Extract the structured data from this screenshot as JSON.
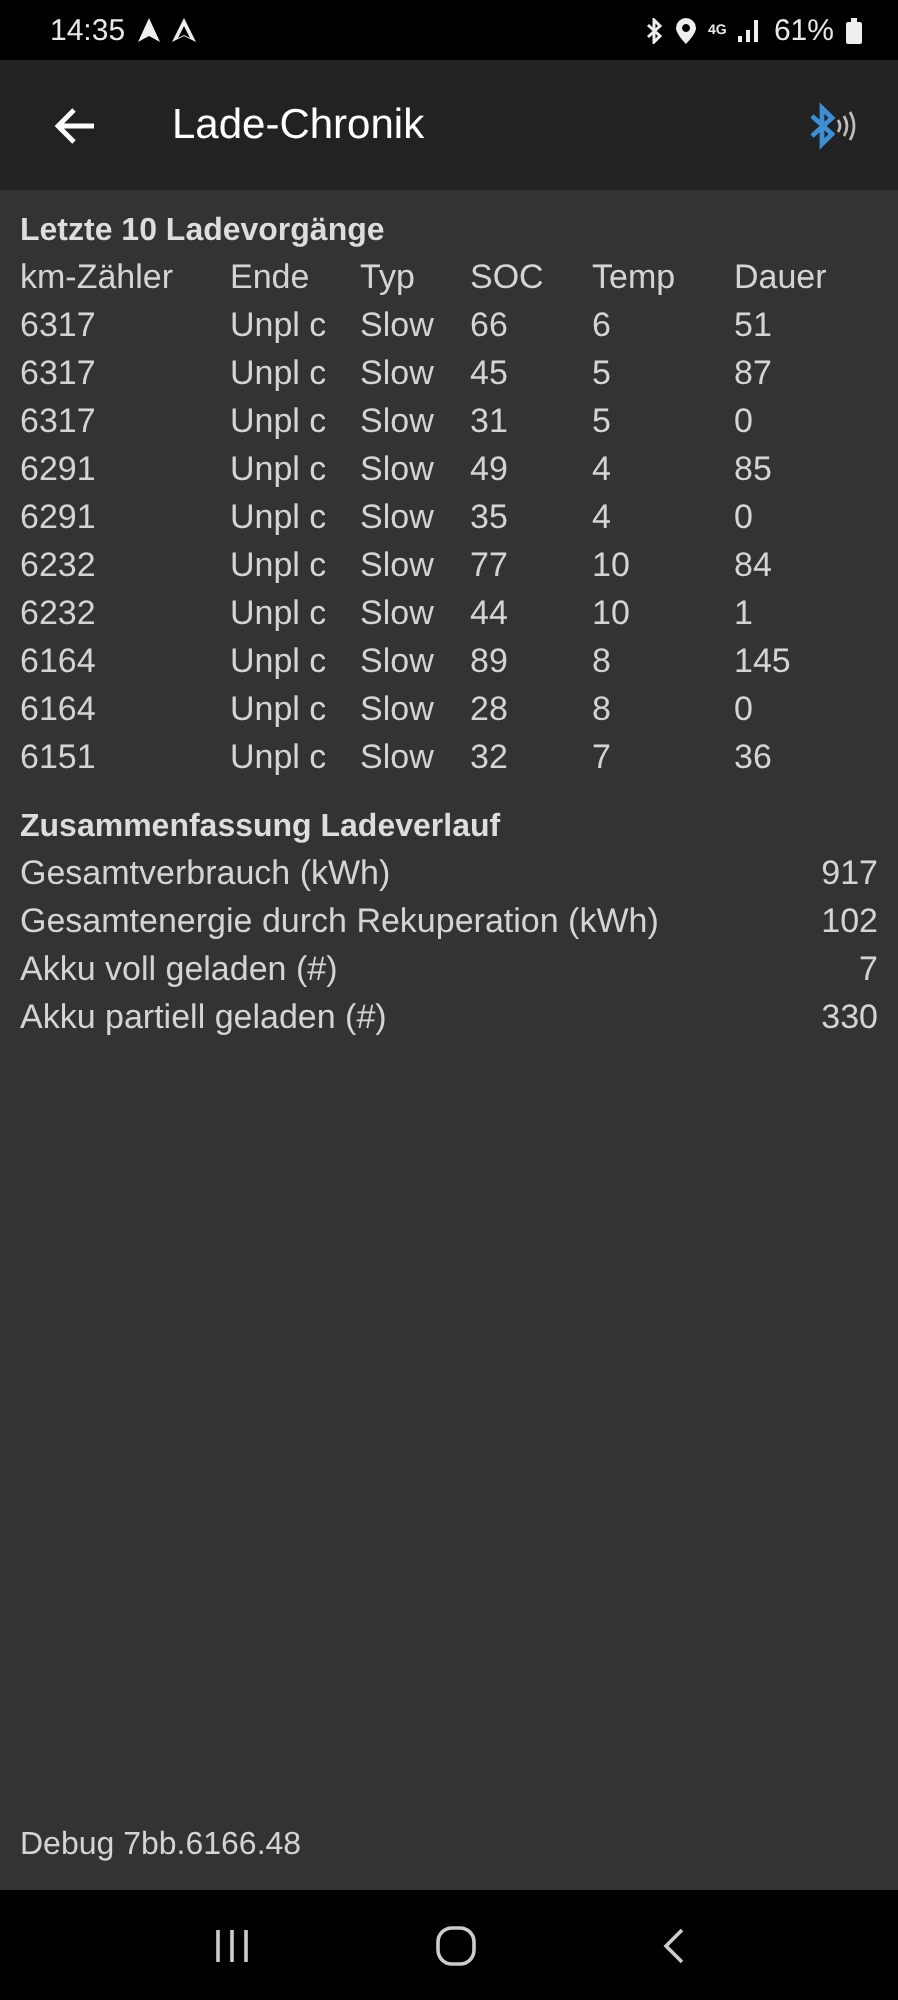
{
  "status_bar": {
    "time": "14:35",
    "network": "4G",
    "battery": "61%"
  },
  "app_bar": {
    "title": "Lade-Chronik"
  },
  "history": {
    "title": "Letzte 10 Ladevorgänge",
    "columns": [
      "km-Zähler",
      "Ende",
      "Typ",
      "SOC",
      "Temp",
      "Dauer"
    ],
    "rows": [
      [
        "6317",
        "Unpl c",
        "Slow",
        "66",
        "6",
        "51"
      ],
      [
        "6317",
        "Unpl c",
        "Slow",
        "45",
        "5",
        "87"
      ],
      [
        "6317",
        "Unpl c",
        "Slow",
        "31",
        "5",
        "0"
      ],
      [
        "6291",
        "Unpl c",
        "Slow",
        "49",
        "4",
        "85"
      ],
      [
        "6291",
        "Unpl c",
        "Slow",
        "35",
        "4",
        "0"
      ],
      [
        "6232",
        "Unpl c",
        "Slow",
        "77",
        "10",
        "84"
      ],
      [
        "6232",
        "Unpl c",
        "Slow",
        "44",
        "10",
        "1"
      ],
      [
        "6164",
        "Unpl c",
        "Slow",
        "89",
        "8",
        "145"
      ],
      [
        "6164",
        "Unpl c",
        "Slow",
        "28",
        "8",
        "0"
      ],
      [
        "6151",
        "Unpl c",
        "Slow",
        "32",
        "7",
        "36"
      ]
    ]
  },
  "summary": {
    "title": "Zusammenfassung Ladeverlauf",
    "items": [
      {
        "label": "Gesamtverbrauch (kWh)",
        "value": "917"
      },
      {
        "label": "Gesamtenergie durch Rekuperation (kWh)",
        "value": "102"
      },
      {
        "label": "Akku voll geladen (#)",
        "value": "7"
      },
      {
        "label": "Akku partiell geladen (#)",
        "value": "330"
      }
    ]
  },
  "footer": {
    "text": "Debug 7bb.6166.48"
  }
}
